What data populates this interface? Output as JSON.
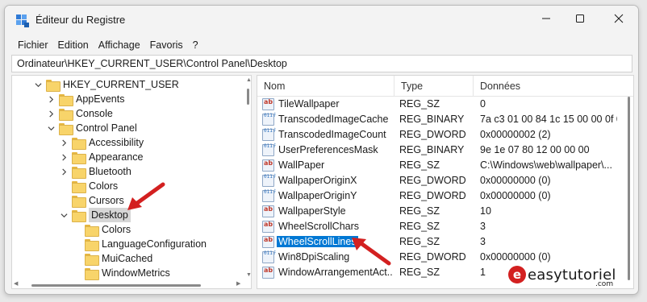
{
  "window": {
    "title": "Éditeur du Registre",
    "controls": [
      "minimize-icon",
      "maximize-icon",
      "close-icon"
    ]
  },
  "menu": [
    "Fichier",
    "Edition",
    "Affichage",
    "Favoris",
    "?"
  ],
  "address": "Ordinateur\\HKEY_CURRENT_USER\\Control Panel\\Desktop",
  "tree": {
    "items": [
      {
        "label": "HKEY_CURRENT_USER",
        "expanded": true,
        "level": 0
      },
      {
        "label": "AppEvents",
        "expanded": false,
        "level": 1
      },
      {
        "label": "Console",
        "expanded": false,
        "level": 1
      },
      {
        "label": "Control Panel",
        "expanded": true,
        "level": 1
      },
      {
        "label": "Accessibility",
        "expanded": false,
        "level": 2
      },
      {
        "label": "Appearance",
        "expanded": false,
        "level": 2
      },
      {
        "label": "Bluetooth",
        "expanded": false,
        "level": 2
      },
      {
        "label": "Colors",
        "level": 2
      },
      {
        "label": "Cursors",
        "level": 2
      },
      {
        "label": "Desktop",
        "expanded": true,
        "selected": true,
        "level": 2
      },
      {
        "label": "Colors",
        "level": 3
      },
      {
        "label": "LanguageConfiguration",
        "level": 3
      },
      {
        "label": "MuiCached",
        "level": 3
      },
      {
        "label": "WindowMetrics",
        "level": 3
      }
    ]
  },
  "list": {
    "headers": [
      "Nom",
      "Type",
      "Données"
    ],
    "rows": [
      {
        "name": "TileWallpaper",
        "type": "REG_SZ",
        "data": "0",
        "icon": "string"
      },
      {
        "name": "TranscodedImageCache",
        "type": "REG_BINARY",
        "data": "7a c3 01 00 84 1c 15 00 00 0f 0...",
        "icon": "binary"
      },
      {
        "name": "TranscodedImageCount",
        "type": "REG_DWORD",
        "data": "0x00000002 (2)",
        "icon": "binary"
      },
      {
        "name": "UserPreferencesMask",
        "type": "REG_BINARY",
        "data": "9e 1e 07 80 12 00 00 00",
        "icon": "binary"
      },
      {
        "name": "WallPaper",
        "type": "REG_SZ",
        "data": "C:\\Windows\\web\\wallpaper\\...",
        "icon": "string"
      },
      {
        "name": "WallpaperOriginX",
        "type": "REG_DWORD",
        "data": "0x00000000 (0)",
        "icon": "binary"
      },
      {
        "name": "WallpaperOriginY",
        "type": "REG_DWORD",
        "data": "0x00000000 (0)",
        "icon": "binary"
      },
      {
        "name": "WallpaperStyle",
        "type": "REG_SZ",
        "data": "10",
        "icon": "string"
      },
      {
        "name": "WheelScrollChars",
        "type": "REG_SZ",
        "data": "3",
        "icon": "string"
      },
      {
        "name": "WheelScrollLines",
        "type": "REG_SZ",
        "data": "3",
        "icon": "string",
        "selected": true
      },
      {
        "name": "Win8DpiScaling",
        "type": "REG_DWORD",
        "data": "0x00000000 (0)",
        "icon": "binary"
      },
      {
        "name": "WindowArrangementAct...",
        "type": "REG_SZ",
        "data": "1",
        "icon": "string"
      }
    ]
  },
  "watermark": {
    "letter": "e",
    "text": "easytutoriel",
    "suffix": ".com"
  },
  "colors": {
    "selection": "#0078d4",
    "arrow": "#d32020"
  }
}
